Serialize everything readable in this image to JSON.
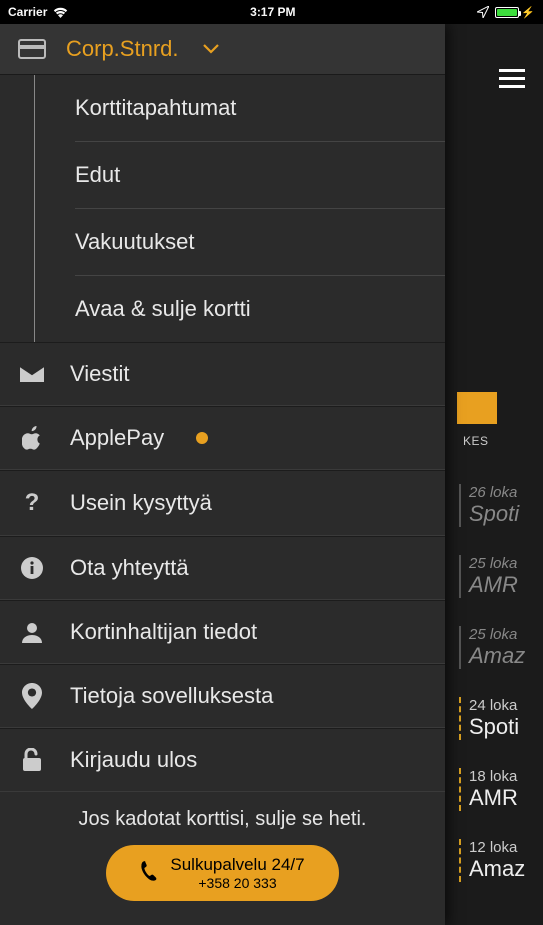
{
  "status": {
    "carrier": "Carrier",
    "time": "3:17 PM"
  },
  "drawer": {
    "card_name": "Corp.Stnrd.",
    "submenu": [
      "Korttitapahtumat",
      "Edut",
      "Vakuutukset",
      "Avaa & sulje kortti"
    ],
    "items": {
      "messages": "Viestit",
      "applepay": "ApplePay",
      "faq": "Usein kysyttyä",
      "contact": "Ota yhteyttä",
      "cardholder": "Kortinhaltijan tiedot",
      "about": "Tietoja sovelluksesta",
      "logout": "Kirjaudu ulos"
    },
    "footer_text": "Jos kadotat korttisi, sulje se heti.",
    "call_button": {
      "line1": "Sulkupalvelu 24/7",
      "line2": "+358 20 333"
    }
  },
  "background": {
    "tab_label": "KES",
    "items": [
      {
        "date": "26 loka",
        "title": "Spoti",
        "highlight": false
      },
      {
        "date": "25 loka",
        "title": "AMR",
        "highlight": false
      },
      {
        "date": "25 loka",
        "title": "Amaz",
        "highlight": false
      },
      {
        "date": "24 loka",
        "title": "Spoti",
        "highlight": true
      },
      {
        "date": "18 loka",
        "title": "AMR",
        "highlight": true
      },
      {
        "date": "12 loka",
        "title": "Amaz",
        "highlight": true
      }
    ]
  }
}
